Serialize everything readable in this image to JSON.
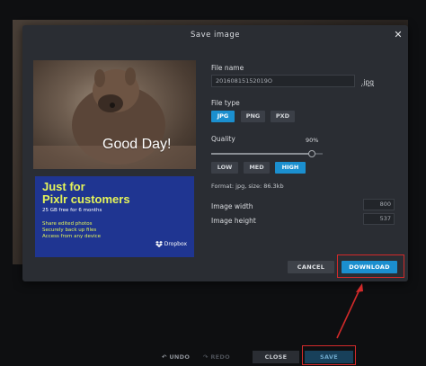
{
  "dialog": {
    "title": "Save image",
    "close_icon": "close-icon"
  },
  "preview": {
    "caption": "Good Day!"
  },
  "ad": {
    "line1": "Just for",
    "line2": "Pixlr customers",
    "subtitle": "25 GB free for 6 months",
    "features": [
      "Share edited photos",
      "Securely back up files",
      "Access from any device"
    ],
    "brand": "Dropbox",
    "brand_icon": "dropbox-icon",
    "background": "#1f3591",
    "accent": "#e4f35a"
  },
  "file_name": {
    "label": "File name",
    "value": "20160815152019O",
    "extension": ".jpg"
  },
  "file_type": {
    "label": "File type",
    "options": [
      "JPG",
      "PNG",
      "PXD"
    ],
    "selected": "JPG"
  },
  "quality": {
    "label": "Quality",
    "value_text": "90%",
    "value": 0.9,
    "presets": [
      "LOW",
      "MED",
      "HIGH"
    ],
    "selected": "HIGH"
  },
  "format_info": "Format: jpg, size: 86.3kb",
  "image_width": {
    "label": "Image width",
    "value": "800"
  },
  "image_height": {
    "label": "Image height",
    "value": "537"
  },
  "actions": {
    "cancel": "CANCEL",
    "download": "DOWNLOAD"
  },
  "bottom_bar": {
    "undo": "UNDO",
    "redo": "REDO",
    "close": "CLOSE",
    "save": "SAVE",
    "undo_icon": "undo-icon",
    "redo_icon": "redo-icon"
  },
  "colors": {
    "accent": "#1b8fcf",
    "highlight": "#d22a2a"
  }
}
